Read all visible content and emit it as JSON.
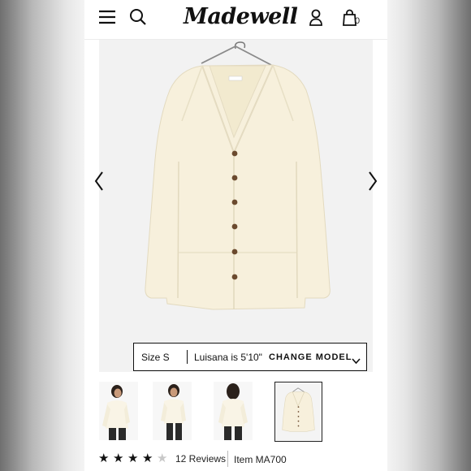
{
  "header": {
    "logo_text": "Madewell",
    "bag_count": "0",
    "icons": [
      "menu-icon",
      "search-icon",
      "account-icon",
      "bag-icon"
    ]
  },
  "gallery": {
    "model_bar": {
      "size_label": "Size S",
      "model_info": "Luisana is 5'10\"",
      "change_model_label": "CHANGE MODEL"
    },
    "thumbnails": [
      "model-front",
      "model-front-alt",
      "model-back",
      "flat-lay"
    ],
    "selected_thumbnail": 4
  },
  "product_meta": {
    "rating": 4,
    "rating_max": 5,
    "reviews_label": "12 Reviews",
    "item_label": "Item MA700"
  },
  "colors": {
    "cardigan": "#f7f0dc",
    "button": "#6b4a2e",
    "star_filled": "#111111",
    "star_empty": "#c8c8c8"
  }
}
